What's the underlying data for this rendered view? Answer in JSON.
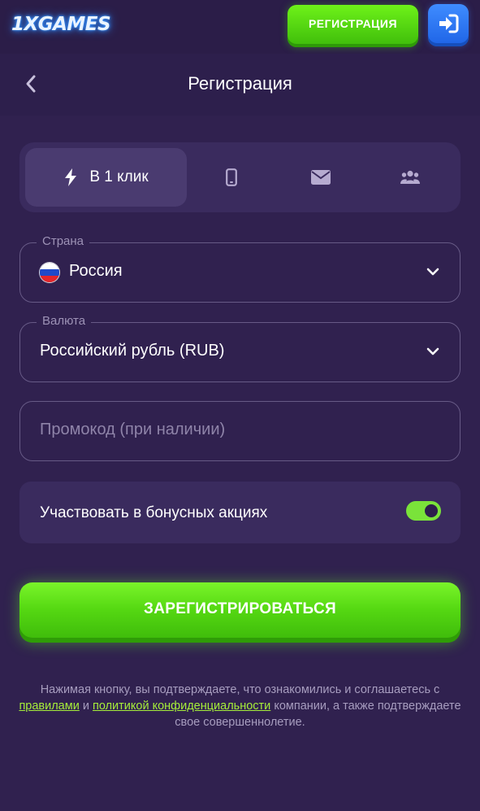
{
  "header": {
    "logo_text": "1XGAMES",
    "register_button": "РЕГИСТРАЦИЯ",
    "login_icon": "sign-in-icon"
  },
  "subheader": {
    "back_icon": "chevron-left-icon",
    "title": "Регистрация"
  },
  "tabs": [
    {
      "label": "В 1 клик",
      "icon": "lightning-icon",
      "active": true
    },
    {
      "label": "",
      "icon": "phone-icon",
      "active": false
    },
    {
      "label": "",
      "icon": "envelope-icon",
      "active": false
    },
    {
      "label": "",
      "icon": "users-icon",
      "active": false
    }
  ],
  "form": {
    "country": {
      "legend": "Страна",
      "value": "Россия",
      "flag": "russia-flag-icon"
    },
    "currency": {
      "legend": "Валюта",
      "value": "Российский рубль (RUB)"
    },
    "promo": {
      "placeholder": "Промокод (при наличии)"
    },
    "bonus": {
      "label": "Участвовать в бонусных акциях",
      "enabled": true
    }
  },
  "submit_button": "ЗАРЕГИСТРИРОВАТЬСЯ",
  "disclaimer": {
    "part1": "Нажимая кнопку, вы подтверждаете, что ознакомились и соглашаетесь с ",
    "rules_link": "правилами",
    "part2": " и ",
    "privacy_link": "политикой конфиденциальности",
    "part3": " компании, а также подтверждаете свое совершеннолетие."
  },
  "colors": {
    "background": "#30214f",
    "accent_green": "#55d812",
    "accent_blue": "#2f74f5",
    "link_green": "#a6ee3a"
  }
}
